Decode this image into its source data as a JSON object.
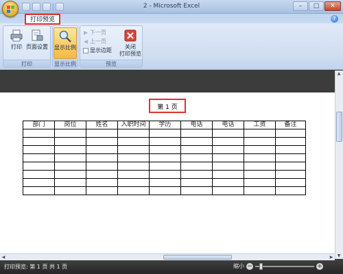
{
  "window": {
    "title": "2 - Microsoft Excel",
    "controls": {
      "minimize": "–",
      "maximize": "□",
      "close": "✕"
    }
  },
  "ribbon": {
    "active_tab": "打印预览",
    "groups": {
      "print": {
        "label": "打印",
        "buttons": {
          "print": "打印",
          "page_setup": "页面设置"
        }
      },
      "zoom": {
        "label": "显示比例",
        "buttons": {
          "zoom": "显示比例"
        }
      },
      "preview": {
        "label": "预览",
        "next_page": "下一页",
        "prev_page": "上一页",
        "show_margins": "显示边距",
        "close_preview_line1": "关闭",
        "close_preview_line2": "打印预览"
      }
    }
  },
  "page": {
    "title": "第 1 页",
    "table_headers": [
      "部门",
      "岗位",
      "姓名",
      "入职时间",
      "学历",
      "电话",
      "电话",
      "工资",
      "备注"
    ],
    "empty_rows": 8
  },
  "statusbar": {
    "text": "打印预览: 第 1 页  共 1 页",
    "zoom_label": "缩小"
  },
  "colors": {
    "highlight_box": "#e03030",
    "ribbon_bg": "#d0def1",
    "dark_band": "#3c3c3c",
    "status_bar": "#2f2f2f"
  }
}
